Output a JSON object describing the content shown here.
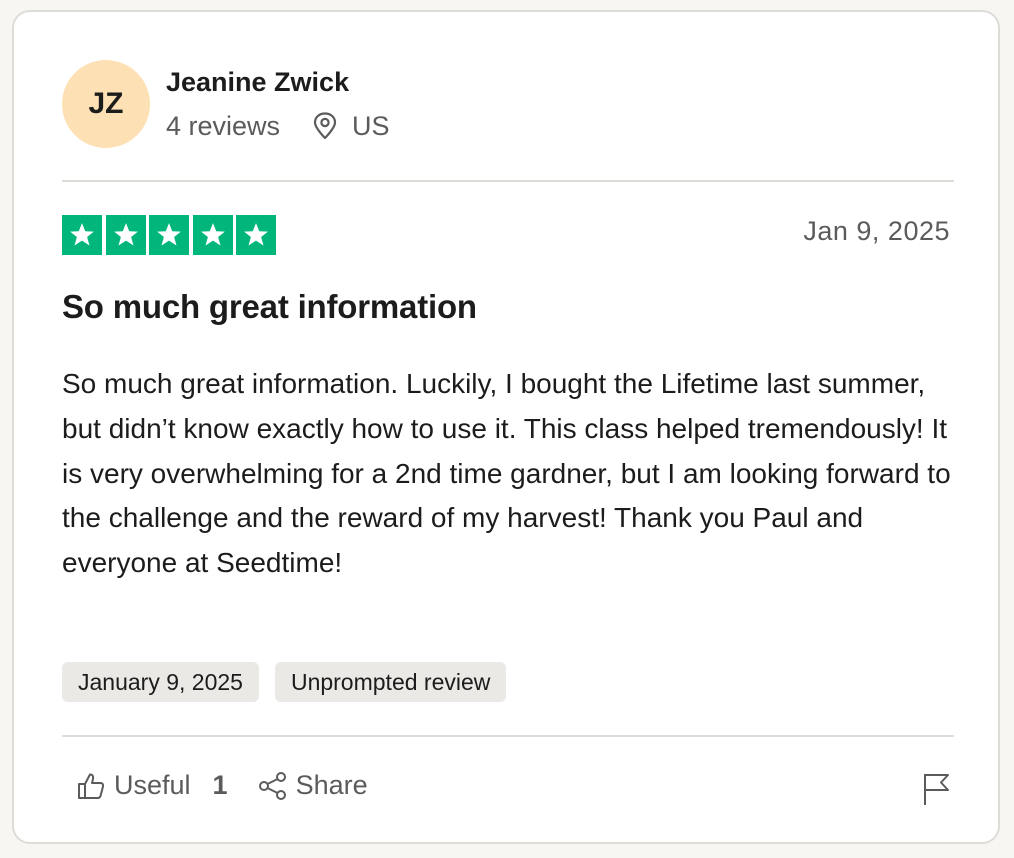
{
  "consumer": {
    "initials": "JZ",
    "name": "Jeanine Zwick",
    "reviews_count": "4 reviews",
    "country": "US",
    "avatar_color": "#fde0b3"
  },
  "review": {
    "rating": 5,
    "max_rating": 5,
    "star_color": "#00b67a",
    "date_short": "Jan 9, 2025",
    "title": "So much great information",
    "body": "So much great information. Luckily, I bought the Lifetime last summer, but didn’t know exactly how to use it. This class helped tremendously!  It is very overwhelming for a 2nd time gardner, but I am looking forward to the challenge and the reward of my harvest! Thank you Paul and everyone at Seedtime!",
    "tags": [
      "January 9, 2025",
      "Unprompted review"
    ]
  },
  "actions": {
    "useful_label": "Useful",
    "useful_count": "1",
    "share_label": "Share"
  },
  "icons": {
    "location": "location-pin-icon",
    "thumb": "thumbs-up-icon",
    "share": "share-icon",
    "flag": "flag-icon"
  }
}
